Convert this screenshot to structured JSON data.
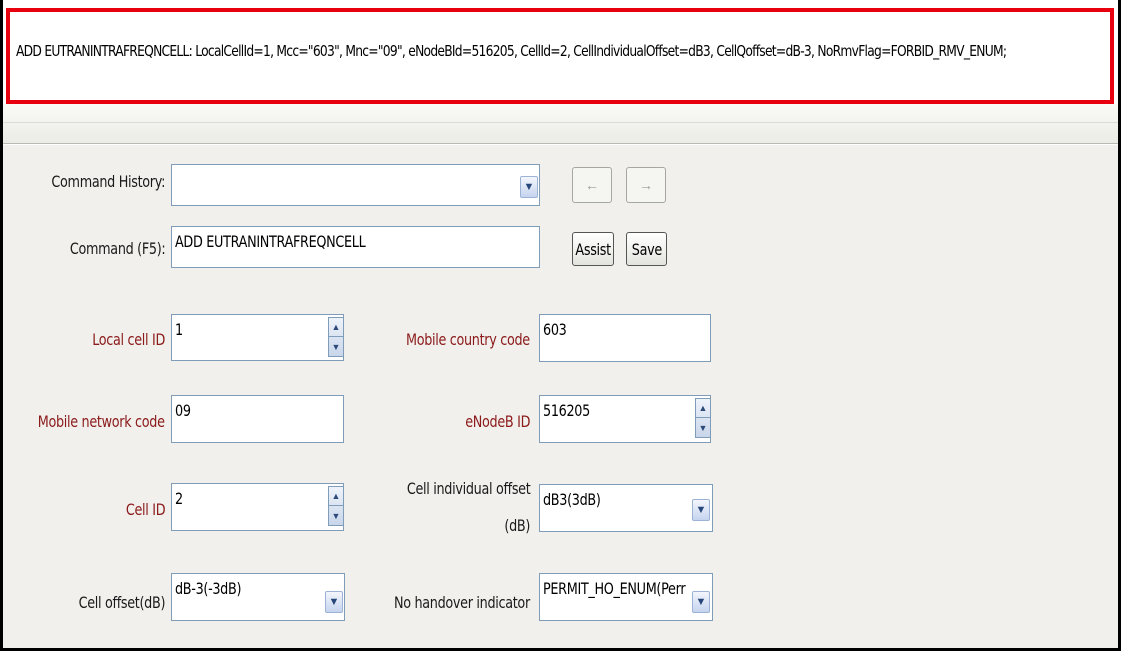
{
  "command_output": "ADD EUTRANINTRAFREQNCELL: LocalCellId=1, Mcc=\"603\", Mnc=\"09\", eNodeBId=516205, CellId=2, CellIndividualOffset=dB3, CellQoffset=dB-3, NoRmvFlag=FORBID_RMV_ENUM;",
  "command_history": {
    "label": "Command History:",
    "value": ""
  },
  "command": {
    "label": "Command (F5):",
    "value": "ADD EUTRANINTRAFREQNCELL"
  },
  "nav": {
    "back": "←",
    "forward": "→"
  },
  "buttons": {
    "assist": "Assist",
    "save": "Save"
  },
  "params": {
    "local_cell_id": {
      "label": "Local cell ID",
      "value": "1"
    },
    "mcc": {
      "label": "Mobile country code",
      "value": "603"
    },
    "mnc": {
      "label": "Mobile network code",
      "value": "09"
    },
    "enodeb_id": {
      "label": "eNodeB ID",
      "value": "516205"
    },
    "cell_id": {
      "label": "Cell ID",
      "value": "2"
    },
    "cell_individual_offset": {
      "label_line1": "Cell individual offset",
      "label_line2": "(dB)",
      "value": "dB3(3dB)"
    },
    "cell_offset": {
      "label": "Cell offset(dB)",
      "value": "dB-3(-3dB)"
    },
    "no_handover_indicator": {
      "label": "No handover indicator",
      "value": "PERMIT_HO_ENUM(Perr"
    }
  },
  "icons": {
    "dropdown": "chevron-down-icon",
    "spin_up": "up-arrow-icon",
    "spin_down": "down-arrow-icon"
  }
}
